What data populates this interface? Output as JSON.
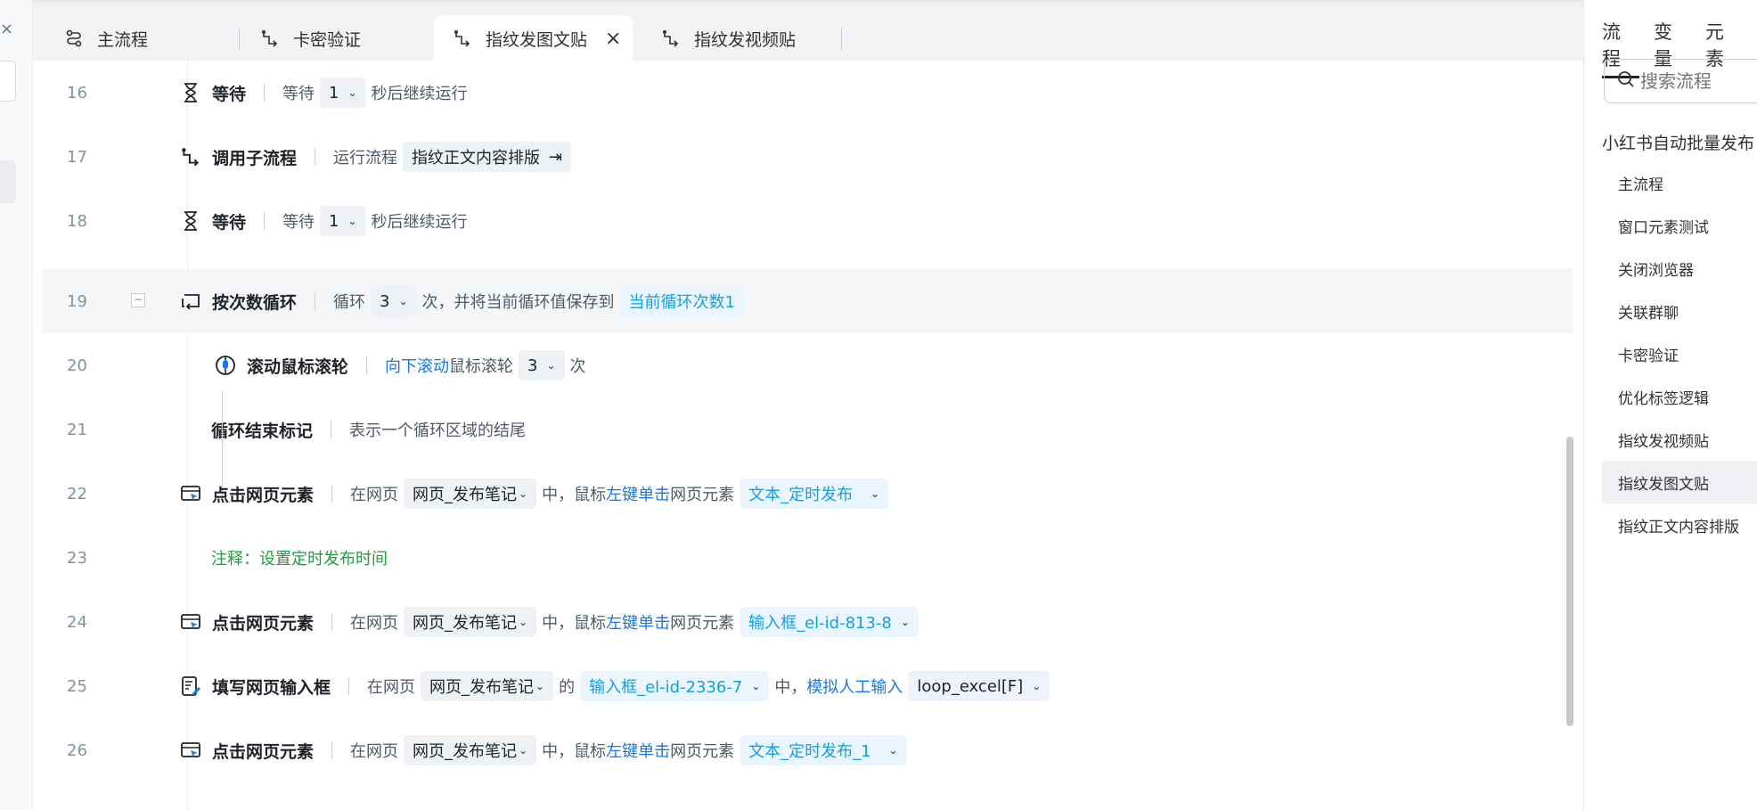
{
  "tabs": [
    {
      "label": "主流程",
      "icon": "main-flow-icon"
    },
    {
      "label": "卡密验证",
      "icon": "subflow-icon"
    },
    {
      "label": "指纹发图文贴",
      "icon": "subflow-icon",
      "active": true
    },
    {
      "label": "指纹发视频贴",
      "icon": "subflow-icon"
    }
  ],
  "steps": {
    "s16": {
      "num": "16",
      "title": "等待",
      "t1": "等待",
      "v": "1",
      "t2": "秒后继续运行"
    },
    "s17": {
      "num": "17",
      "title": "调用子流程",
      "t1": "运行流程",
      "v": "指纹正文内容排版"
    },
    "s18": {
      "num": "18",
      "title": "等待",
      "t1": "等待",
      "v": "1",
      "t2": "秒后继续运行"
    },
    "s19": {
      "num": "19",
      "title": "按次数循环",
      "t1": "循环",
      "v": "3",
      "t2": "次，并将当前循环值保存到",
      "var": "当前循环次数1"
    },
    "s20": {
      "num": "20",
      "title": "滚动鼠标滚轮",
      "dir": "向下滚动",
      "t1": "鼠标滚轮",
      "v": "3",
      "t2": "次"
    },
    "s21": {
      "num": "21",
      "title": "循环结束标记",
      "t1": "表示一个循环区域的结尾"
    },
    "s22": {
      "num": "22",
      "title": "点击网页元素",
      "t1": "在网页",
      "page": "网页_发布笔记",
      "t2": "中，鼠标",
      "action": "左键单击",
      "t3": "网页元素",
      "el": "文本_定时发布"
    },
    "s23": {
      "num": "23",
      "comment": "注释：设置定时发布时间"
    },
    "s24": {
      "num": "24",
      "title": "点击网页元素",
      "t1": "在网页",
      "page": "网页_发布笔记",
      "t2": "中，鼠标",
      "action": "左键单击",
      "t3": "网页元素",
      "el": "输入框_el-id-813-8"
    },
    "s25": {
      "num": "25",
      "title": "填写网页输入框",
      "t1": "在网页",
      "page": "网页_发布笔记",
      "t2": "的",
      "el": "输入框_el-id-2336-7",
      "t3": "中，",
      "mode": "模拟人工输入",
      "val": "loop_excel[F]"
    },
    "s26": {
      "num": "26",
      "title": "点击网页元素",
      "t1": "在网页",
      "page": "网页_发布笔记",
      "t2": "中，鼠标",
      "action": "左键单击",
      "t3": "网页元素",
      "el": "文本_定时发布_1"
    }
  },
  "right_panel": {
    "tabs": [
      "流程",
      "变量",
      "元素"
    ],
    "search_placeholder": "搜索流程",
    "group": "小红书自动批量发布",
    "items": [
      "主流程",
      "窗口元素测试",
      "关闭浏览器",
      "关联群聊",
      "卡密验证",
      "优化标签逻辑",
      "指纹发视频贴",
      "指纹发图文贴",
      "指纹正文内容排版"
    ],
    "active_item": "指纹发图文贴"
  },
  "left_strip": {
    "close": "×"
  }
}
